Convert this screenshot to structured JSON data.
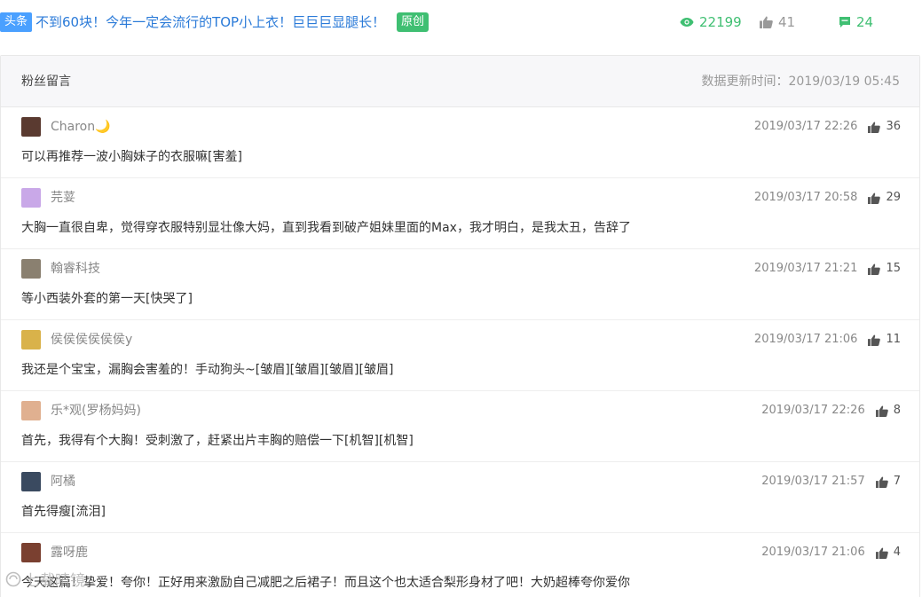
{
  "article": {
    "tag_head": "头条",
    "title": "不到60块！今年一定会流行的TOP小上衣！巨巨巨显腿长！",
    "tag_original": "原创",
    "views": "22199",
    "likes": "41",
    "comments": "24"
  },
  "panel": {
    "title": "粉丝留言",
    "update": "数据更新时间：2019/03/19 05:45"
  },
  "comments": [
    {
      "nick": "Charon🌙",
      "time": "2019/03/17 22:26",
      "likes": "36",
      "text": "可以再推荐一波小胸妹子的衣服嘛[害羞]",
      "avatar_color": "#5a3a30"
    },
    {
      "nick": "芫荽",
      "time": "2019/03/17 20:58",
      "likes": "29",
      "text": "大胸一直很自卑，觉得穿衣服特别显壮像大妈，直到我看到破产姐妹里面的Max，我才明白，是我太丑，告辞了",
      "avatar_color": "#c9a8e8"
    },
    {
      "nick": "翰睿科技",
      "time": "2019/03/17 21:21",
      "likes": "15",
      "text": "等小西装外套的第一天[快哭了]",
      "avatar_color": "#8a8070"
    },
    {
      "nick": "侯侯侯侯侯侯y",
      "time": "2019/03/17 21:06",
      "likes": "11",
      "text": "我还是个宝宝，漏胸会害羞的！手动狗头~[皱眉][皱眉][皱眉][皱眉]",
      "avatar_color": "#d9b24a"
    },
    {
      "nick": "乐*观(罗杨妈妈)",
      "time": "2019/03/17 22:26",
      "likes": "8",
      "text": "首先，我得有个大胸！受刺激了，赶紧出片丰胸的赔偿一下[机智][机智]",
      "avatar_color": "#e0b090"
    },
    {
      "nick": "阿橘",
      "time": "2019/03/17 21:57",
      "likes": "7",
      "text": "首先得瘦[流泪]",
      "avatar_color": "#3a4a60"
    },
    {
      "nick": "露呀鹿",
      "time": "2019/03/17 21:06",
      "likes": "4",
      "text": "今天这篇！挚爱！夸你！正好用来激励自己减肥之后裙子！而且这个也太适合梨形身材了吧！大奶超棒夸你爱你",
      "avatar_color": "#7a4030"
    }
  ],
  "watermark": "七载晴镜"
}
